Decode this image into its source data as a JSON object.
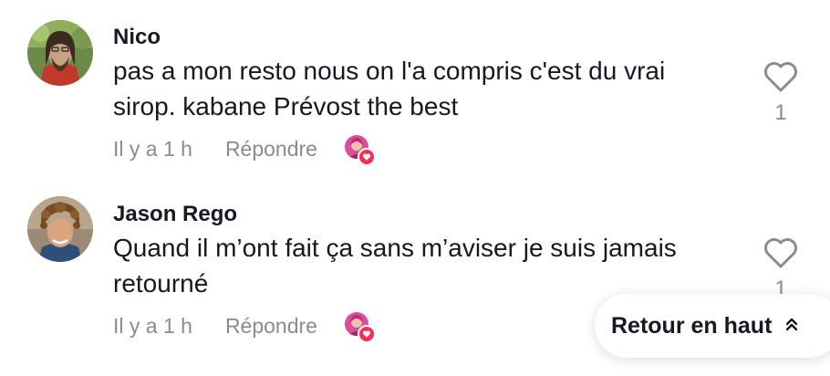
{
  "comments": [
    {
      "username": "Nico",
      "lines": [
        "pas a mon resto nous on l'a compris c'est du vrai",
        "sirop. kabane Prévost the best"
      ],
      "time": "Il y a 1 h",
      "reply_label": "Répondre",
      "like_count": "1"
    },
    {
      "username": "Jason Rego",
      "lines": [
        "Quand il m’ont fait ça sans m’aviser je suis jamais",
        "retourné"
      ],
      "time": "Il y a 1 h",
      "reply_label": "Répondre",
      "like_count": "1"
    }
  ],
  "back_to_top": {
    "label": "Retour en haut",
    "icon": "double-chevron-up-icon"
  },
  "colors": {
    "text_primary": "#161823",
    "text_secondary": "#8a8b91",
    "accent_heart": "#fe2c55",
    "background": "#ffffff"
  }
}
